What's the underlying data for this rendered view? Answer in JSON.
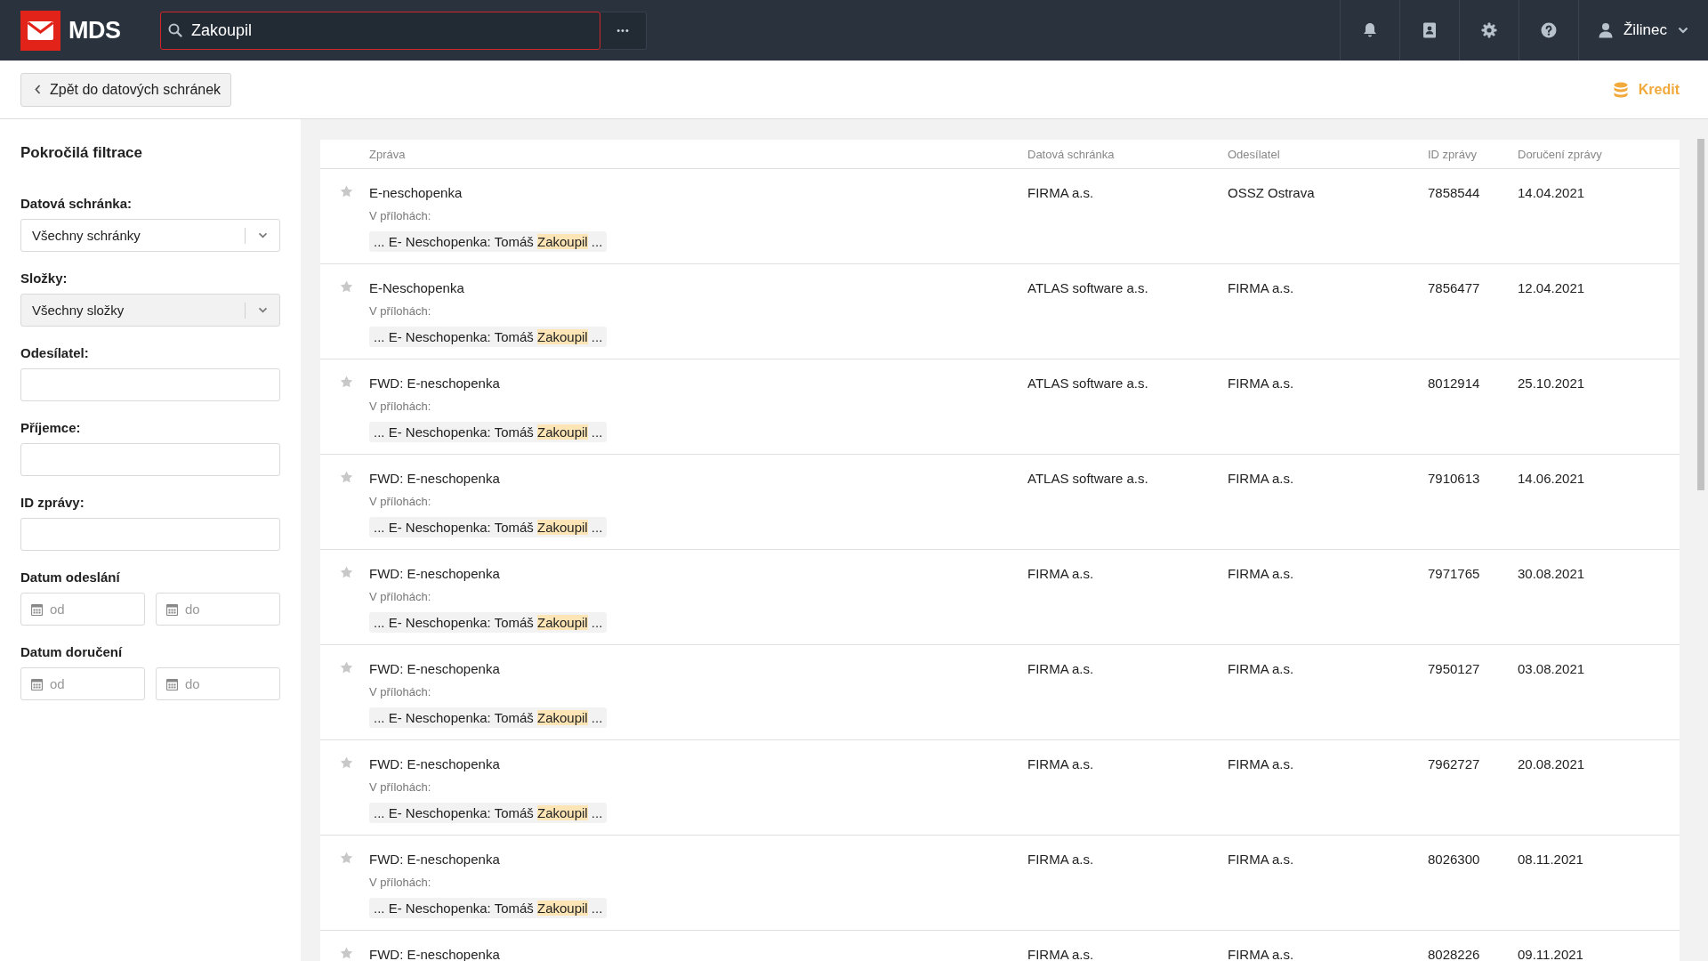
{
  "header": {
    "logo": "MDS",
    "search": {
      "value": "Zakoupil"
    },
    "more_button": "•••",
    "user": "Žilinec"
  },
  "toolbar": {
    "back_button": "Zpět do datových schránek",
    "credit": "Kredit"
  },
  "filters": {
    "title": "Pokročilá filtrace",
    "fields": [
      {
        "kind": "select",
        "label": "Datová schránka:",
        "value": "Všechny schránky",
        "disabled": false
      },
      {
        "kind": "select",
        "label": "Složky:",
        "value": "Všechny složky",
        "disabled": true
      },
      {
        "kind": "text",
        "label": "Odesílatel:"
      },
      {
        "kind": "text",
        "label": "Příjemce:"
      },
      {
        "kind": "text",
        "label": "ID zprávy:"
      },
      {
        "kind": "daterange",
        "label": "Datum odeslání",
        "from_placeholder": "od",
        "to_placeholder": "do"
      },
      {
        "kind": "daterange",
        "label": "Datum doručení",
        "from_placeholder": "od",
        "to_placeholder": "do"
      }
    ]
  },
  "table": {
    "columns": [
      "Zpráva",
      "Datová schránka",
      "Odesílatel",
      "ID zprávy",
      "Doručení zprávy"
    ],
    "rows": [
      {
        "starred": false,
        "subject": "E-neschopenka",
        "attachments_label": "V přílohách:",
        "snippet": {
          "before": "... E- Neschopenka: Tomáš ",
          "highlight": "Zakoupil",
          "after": " ..."
        },
        "databox": "FIRMA a.s.",
        "sender": "OSSZ Ostrava",
        "id": "7858544",
        "delivered": "14.04.2021"
      },
      {
        "starred": false,
        "subject": "E-Neschopenka",
        "attachments_label": "V přílohách:",
        "snippet": {
          "before": "... E- Neschopenka: Tomáš ",
          "highlight": "Zakoupil",
          "after": " ..."
        },
        "databox": "ATLAS software a.s.",
        "sender": "FIRMA a.s.",
        "id": "7856477",
        "delivered": "12.04.2021"
      },
      {
        "starred": false,
        "subject": "FWD: E-neschopenka",
        "attachments_label": "V přílohách:",
        "snippet": {
          "before": "... E- Neschopenka: Tomáš ",
          "highlight": "Zakoupil",
          "after": " ..."
        },
        "databox": "ATLAS software a.s.",
        "sender": "FIRMA a.s.",
        "id": "8012914",
        "delivered": "25.10.2021"
      },
      {
        "starred": false,
        "subject": "FWD: E-neschopenka",
        "attachments_label": "V přílohách:",
        "snippet": {
          "before": "... E- Neschopenka: Tomáš ",
          "highlight": "Zakoupil",
          "after": " ..."
        },
        "databox": "ATLAS software a.s.",
        "sender": "FIRMA a.s.",
        "id": "7910613",
        "delivered": "14.06.2021"
      },
      {
        "starred": false,
        "subject": "FWD: E-neschopenka",
        "attachments_label": "V přílohách:",
        "snippet": {
          "before": "... E- Neschopenka: Tomáš ",
          "highlight": "Zakoupil",
          "after": " ..."
        },
        "databox": "FIRMA a.s.",
        "sender": "FIRMA a.s.",
        "id": "7971765",
        "delivered": "30.08.2021"
      },
      {
        "starred": false,
        "subject": "FWD: E-neschopenka",
        "attachments_label": "V přílohách:",
        "snippet": {
          "before": "... E- Neschopenka: Tomáš ",
          "highlight": "Zakoupil",
          "after": " ..."
        },
        "databox": "FIRMA a.s.",
        "sender": "FIRMA a.s.",
        "id": "7950127",
        "delivered": "03.08.2021"
      },
      {
        "starred": false,
        "subject": "FWD: E-neschopenka",
        "attachments_label": "V přílohách:",
        "snippet": {
          "before": "... E- Neschopenka: Tomáš ",
          "highlight": "Zakoupil",
          "after": " ..."
        },
        "databox": "FIRMA a.s.",
        "sender": "FIRMA a.s.",
        "id": "7962727",
        "delivered": "20.08.2021"
      },
      {
        "starred": false,
        "subject": "FWD: E-neschopenka",
        "attachments_label": "V přílohách:",
        "snippet": {
          "before": "... E- Neschopenka: Tomáš ",
          "highlight": "Zakoupil",
          "after": " ..."
        },
        "databox": "FIRMA a.s.",
        "sender": "FIRMA a.s.",
        "id": "8026300",
        "delivered": "08.11.2021"
      },
      {
        "starred": false,
        "subject": "FWD: E-neschopenka",
        "databox": "FIRMA a.s.",
        "sender": "FIRMA a.s.",
        "id": "8028226",
        "delivered": "09.11.2021"
      }
    ]
  }
}
